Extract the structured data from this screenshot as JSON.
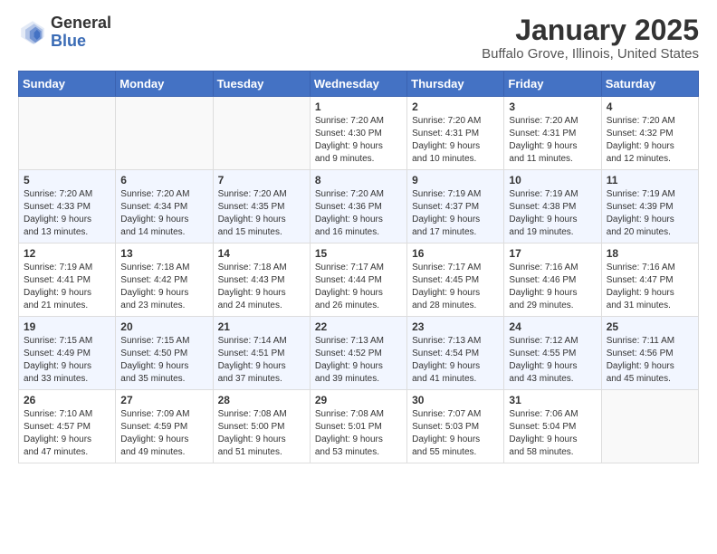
{
  "header": {
    "logo_general": "General",
    "logo_blue": "Blue",
    "title": "January 2025",
    "subtitle": "Buffalo Grove, Illinois, United States"
  },
  "calendar": {
    "days_of_week": [
      "Sunday",
      "Monday",
      "Tuesday",
      "Wednesday",
      "Thursday",
      "Friday",
      "Saturday"
    ],
    "weeks": [
      [
        {
          "day": "",
          "info": ""
        },
        {
          "day": "",
          "info": ""
        },
        {
          "day": "",
          "info": ""
        },
        {
          "day": "1",
          "info": "Sunrise: 7:20 AM\nSunset: 4:30 PM\nDaylight: 9 hours\nand 9 minutes."
        },
        {
          "day": "2",
          "info": "Sunrise: 7:20 AM\nSunset: 4:31 PM\nDaylight: 9 hours\nand 10 minutes."
        },
        {
          "day": "3",
          "info": "Sunrise: 7:20 AM\nSunset: 4:31 PM\nDaylight: 9 hours\nand 11 minutes."
        },
        {
          "day": "4",
          "info": "Sunrise: 7:20 AM\nSunset: 4:32 PM\nDaylight: 9 hours\nand 12 minutes."
        }
      ],
      [
        {
          "day": "5",
          "info": "Sunrise: 7:20 AM\nSunset: 4:33 PM\nDaylight: 9 hours\nand 13 minutes."
        },
        {
          "day": "6",
          "info": "Sunrise: 7:20 AM\nSunset: 4:34 PM\nDaylight: 9 hours\nand 14 minutes."
        },
        {
          "day": "7",
          "info": "Sunrise: 7:20 AM\nSunset: 4:35 PM\nDaylight: 9 hours\nand 15 minutes."
        },
        {
          "day": "8",
          "info": "Sunrise: 7:20 AM\nSunset: 4:36 PM\nDaylight: 9 hours\nand 16 minutes."
        },
        {
          "day": "9",
          "info": "Sunrise: 7:19 AM\nSunset: 4:37 PM\nDaylight: 9 hours\nand 17 minutes."
        },
        {
          "day": "10",
          "info": "Sunrise: 7:19 AM\nSunset: 4:38 PM\nDaylight: 9 hours\nand 19 minutes."
        },
        {
          "day": "11",
          "info": "Sunrise: 7:19 AM\nSunset: 4:39 PM\nDaylight: 9 hours\nand 20 minutes."
        }
      ],
      [
        {
          "day": "12",
          "info": "Sunrise: 7:19 AM\nSunset: 4:41 PM\nDaylight: 9 hours\nand 21 minutes."
        },
        {
          "day": "13",
          "info": "Sunrise: 7:18 AM\nSunset: 4:42 PM\nDaylight: 9 hours\nand 23 minutes."
        },
        {
          "day": "14",
          "info": "Sunrise: 7:18 AM\nSunset: 4:43 PM\nDaylight: 9 hours\nand 24 minutes."
        },
        {
          "day": "15",
          "info": "Sunrise: 7:17 AM\nSunset: 4:44 PM\nDaylight: 9 hours\nand 26 minutes."
        },
        {
          "day": "16",
          "info": "Sunrise: 7:17 AM\nSunset: 4:45 PM\nDaylight: 9 hours\nand 28 minutes."
        },
        {
          "day": "17",
          "info": "Sunrise: 7:16 AM\nSunset: 4:46 PM\nDaylight: 9 hours\nand 29 minutes."
        },
        {
          "day": "18",
          "info": "Sunrise: 7:16 AM\nSunset: 4:47 PM\nDaylight: 9 hours\nand 31 minutes."
        }
      ],
      [
        {
          "day": "19",
          "info": "Sunrise: 7:15 AM\nSunset: 4:49 PM\nDaylight: 9 hours\nand 33 minutes."
        },
        {
          "day": "20",
          "info": "Sunrise: 7:15 AM\nSunset: 4:50 PM\nDaylight: 9 hours\nand 35 minutes."
        },
        {
          "day": "21",
          "info": "Sunrise: 7:14 AM\nSunset: 4:51 PM\nDaylight: 9 hours\nand 37 minutes."
        },
        {
          "day": "22",
          "info": "Sunrise: 7:13 AM\nSunset: 4:52 PM\nDaylight: 9 hours\nand 39 minutes."
        },
        {
          "day": "23",
          "info": "Sunrise: 7:13 AM\nSunset: 4:54 PM\nDaylight: 9 hours\nand 41 minutes."
        },
        {
          "day": "24",
          "info": "Sunrise: 7:12 AM\nSunset: 4:55 PM\nDaylight: 9 hours\nand 43 minutes."
        },
        {
          "day": "25",
          "info": "Sunrise: 7:11 AM\nSunset: 4:56 PM\nDaylight: 9 hours\nand 45 minutes."
        }
      ],
      [
        {
          "day": "26",
          "info": "Sunrise: 7:10 AM\nSunset: 4:57 PM\nDaylight: 9 hours\nand 47 minutes."
        },
        {
          "day": "27",
          "info": "Sunrise: 7:09 AM\nSunset: 4:59 PM\nDaylight: 9 hours\nand 49 minutes."
        },
        {
          "day": "28",
          "info": "Sunrise: 7:08 AM\nSunset: 5:00 PM\nDaylight: 9 hours\nand 51 minutes."
        },
        {
          "day": "29",
          "info": "Sunrise: 7:08 AM\nSunset: 5:01 PM\nDaylight: 9 hours\nand 53 minutes."
        },
        {
          "day": "30",
          "info": "Sunrise: 7:07 AM\nSunset: 5:03 PM\nDaylight: 9 hours\nand 55 minutes."
        },
        {
          "day": "31",
          "info": "Sunrise: 7:06 AM\nSunset: 5:04 PM\nDaylight: 9 hours\nand 58 minutes."
        },
        {
          "day": "",
          "info": ""
        }
      ]
    ]
  }
}
